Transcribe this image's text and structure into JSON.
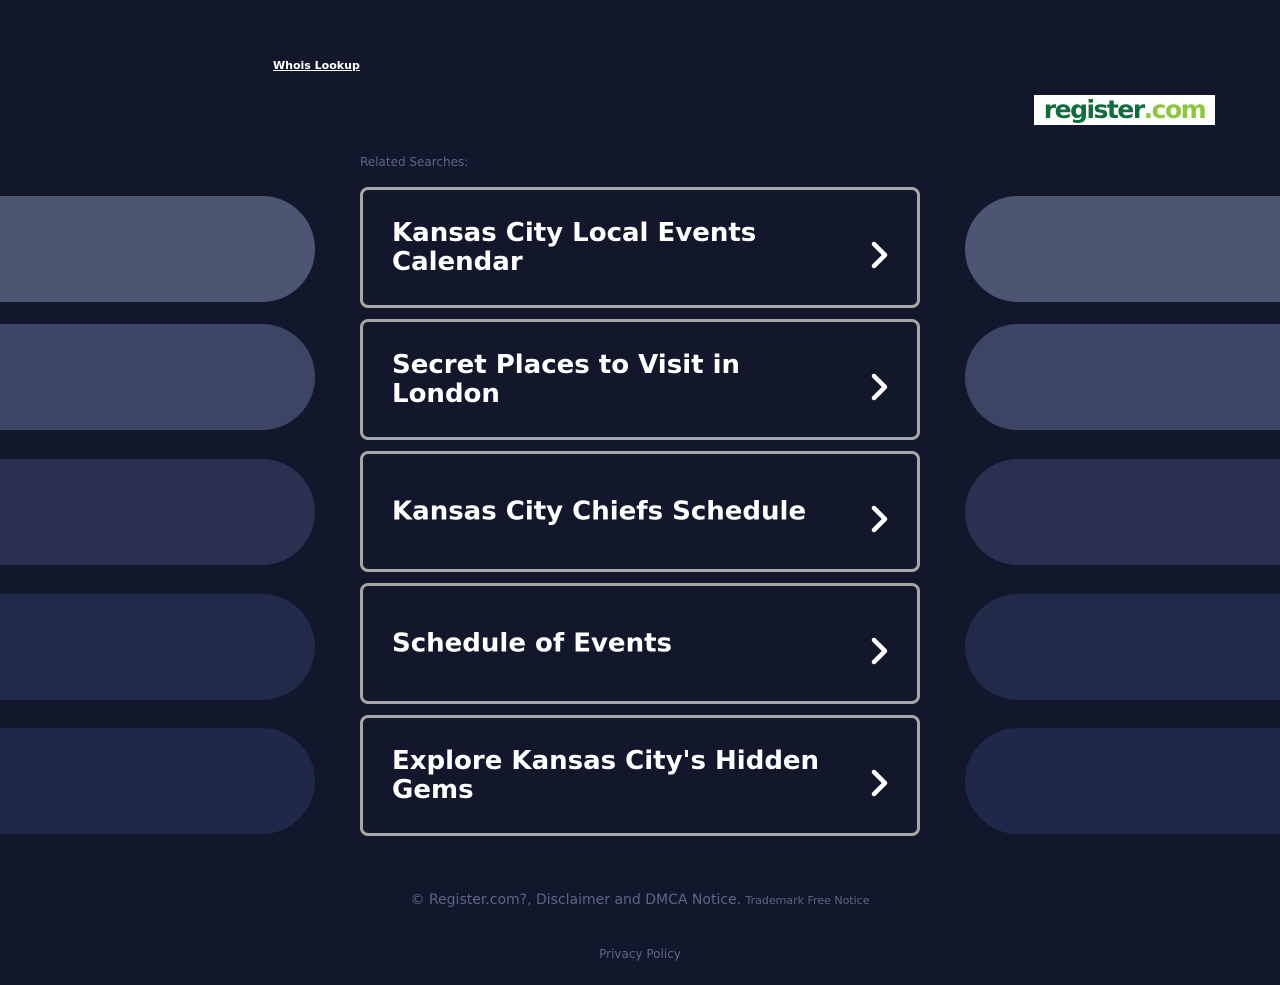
{
  "header": {
    "whois_link": "Whois Lookup",
    "logo": {
      "main": "register",
      "tld": ".com",
      "brand_color": "#0f6d3b",
      "accent_color": "#8cc63f"
    }
  },
  "related": {
    "label": "Related Searches:",
    "links": [
      "Kansas City Local Events Calendar",
      "Secret Places to Visit in London",
      "Kansas City Chiefs Schedule",
      "Schedule of Events",
      "Explore Kansas City's Hidden Gems"
    ],
    "chevron_icon": "chevron-right-icon"
  },
  "footer": {
    "copyright": "© Register.com?, Disclaimer and DMCA Notice.",
    "trademark": "Trademark Free Notice",
    "privacy": "Privacy Policy"
  },
  "colors": {
    "background": "#12172c",
    "card_border": "#a6a6a6",
    "muted_text": "#5a6687",
    "pill_shades": [
      "#4c5672",
      "#3c4563",
      "#2a3150",
      "#222a49",
      "#1f2849"
    ]
  }
}
